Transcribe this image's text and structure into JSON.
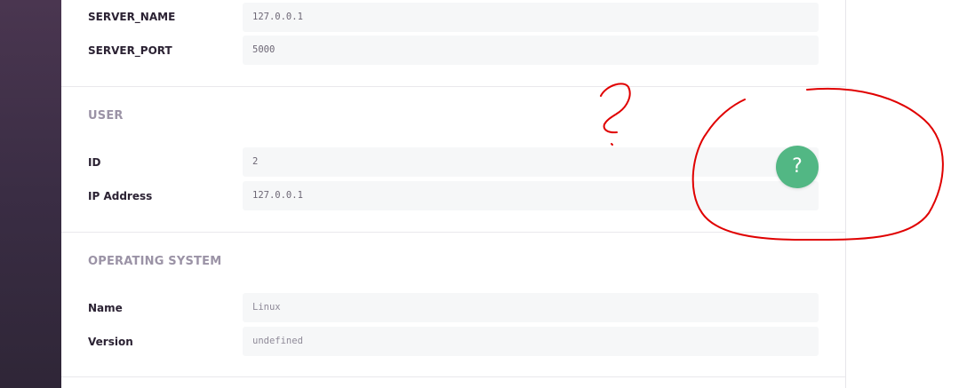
{
  "server": {
    "rows": [
      {
        "label": "SERVER_NAME",
        "value": "127.0.0.1"
      },
      {
        "label": "SERVER_PORT",
        "value": "5000"
      }
    ]
  },
  "user": {
    "title": "USER",
    "rows": [
      {
        "label": "ID",
        "value": "2"
      },
      {
        "label": "IP Address",
        "value": "127.0.0.1"
      }
    ]
  },
  "os": {
    "title": "OPERATING SYSTEM",
    "rows": [
      {
        "label": "Name",
        "value": "Linux"
      },
      {
        "label": "Version",
        "value": "undefined"
      }
    ]
  },
  "help_button": {
    "label": "?",
    "color": "#52b784"
  },
  "annotation": {
    "glyph": "?",
    "color": "#e00000"
  }
}
